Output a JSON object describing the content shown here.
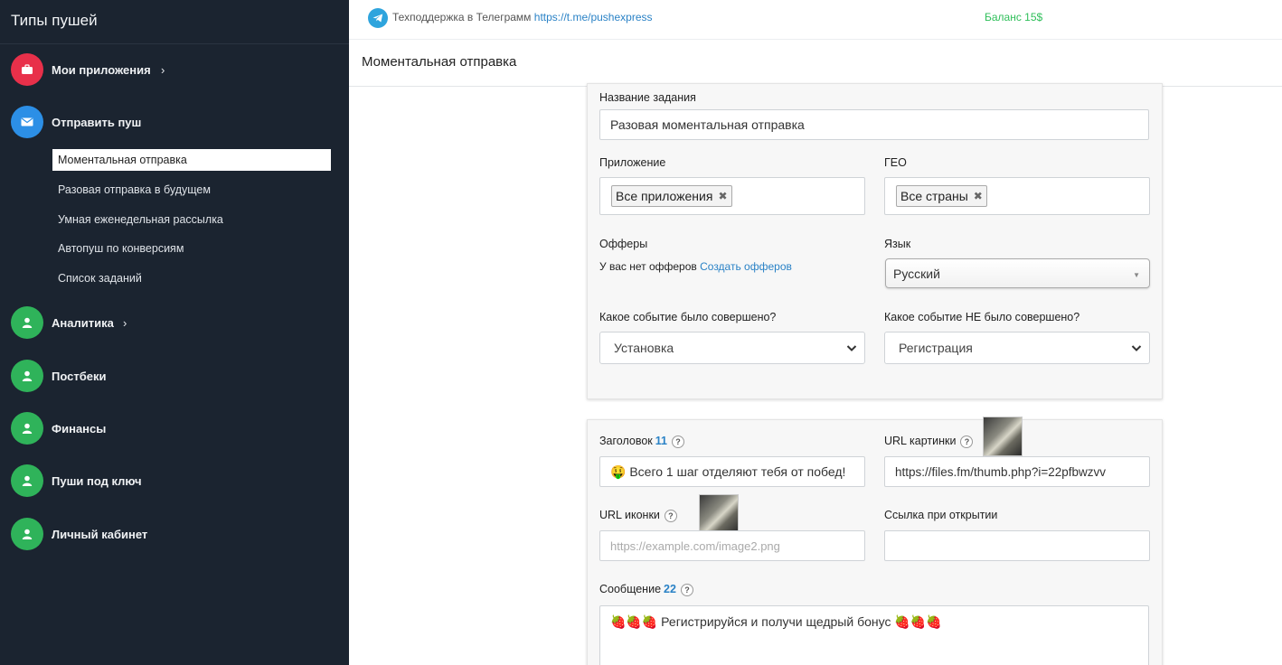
{
  "sidebar": {
    "title": "Типы пушей",
    "items": [
      {
        "label": "Мои приложения",
        "icon": "briefcase-icon",
        "color": "#e8304a",
        "chevron": "›"
      },
      {
        "label": "Отправить пуш",
        "icon": "envelope-icon",
        "color": "#2c8fe6",
        "chevron": ""
      },
      {
        "label": "Аналитика",
        "icon": "user-icon",
        "color": "#2fb35a",
        "chevron": "›"
      },
      {
        "label": "Постбеки",
        "icon": "user-icon",
        "color": "#2fb35a",
        "chevron": ""
      },
      {
        "label": "Финансы",
        "icon": "user-icon",
        "color": "#2fb35a",
        "chevron": ""
      },
      {
        "label": "Пуши под ключ",
        "icon": "user-icon",
        "color": "#2fb35a",
        "chevron": ""
      },
      {
        "label": "Личный кабинет",
        "icon": "user-icon",
        "color": "#2fb35a",
        "chevron": ""
      }
    ],
    "subitems": [
      "Моментальная отправка",
      "Разовая отправка в будущем",
      "Умная еженедельная рассылка",
      "Автопуш по конверсиям",
      "Список заданий"
    ]
  },
  "topbar": {
    "support_text": "Техподдержка в Телеграмм",
    "support_link": "https://t.me/pushexpress",
    "balance": "Баланс 15$"
  },
  "page_title": "Моментальная отправка",
  "form1": {
    "task_name_label": "Название задания",
    "task_name_value": "Разовая моментальная отправка",
    "app_label": "Приложение",
    "app_tag": "Все приложения",
    "geo_label": "ГЕО",
    "geo_tag": "Все страны",
    "offers_label": "Офферы",
    "offers_text": "У вас нет офферов",
    "offers_link": "Создать офферов",
    "lang_label": "Язык",
    "lang_value": "Русский",
    "event_done_label": "Какое событие было совершено?",
    "event_done_value": "Установка",
    "event_not_done_label": "Какое событие НЕ было совершено?",
    "event_not_done_value": "Регистрация"
  },
  "form2": {
    "title_label": "Заголовок",
    "title_count": "11",
    "title_value": "🤑 Всего 1 шаг отделяют тебя от побед!",
    "image_url_label": "URL картинки",
    "image_url_value": "https://files.fm/thumb.php?i=22pfbwzvv",
    "icon_url_label": "URL иконки",
    "icon_url_placeholder": "https://example.com/image2.png",
    "open_link_label": "Ссылка при открытии",
    "open_link_value": "",
    "message_label": "Сообщение",
    "message_count": "22",
    "message_value": "🍓🍓🍓 Регистрируйся и получи щедрый бонус 🍓🍓🍓"
  },
  "help_glyph": "?",
  "tag_close_glyph": "✖",
  "select_arrow_glyph": "▼"
}
